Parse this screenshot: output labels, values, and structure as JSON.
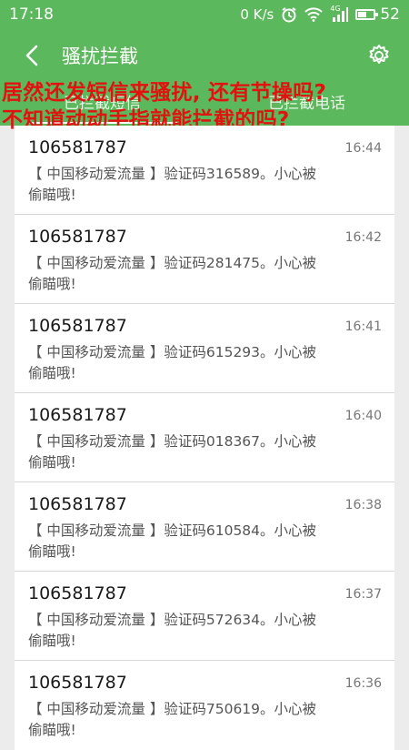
{
  "status_bar": {
    "time": "17:18",
    "data_speed": "0 K/s",
    "network_label": "4G",
    "battery_level": "52",
    "battery_fraction": 0.52
  },
  "app_bar": {
    "title": "骚扰拦截",
    "back_icon": "chevron-left-icon",
    "settings_icon": "gear-icon"
  },
  "tabs": [
    {
      "label": "已拦截短信",
      "active": true
    },
    {
      "label": "已拦截电话",
      "active": false
    }
  ],
  "overlay": {
    "line1": "居然还发短信来骚扰, 还有节操吗?",
    "line2": "不知道动动手指就能拦截的吗?"
  },
  "messages": [
    {
      "sender": "106581787",
      "time": "16:44",
      "text": "【 中国移动爱流量 】验证码316589。小心被偷瞄哦!"
    },
    {
      "sender": "106581787",
      "time": "16:42",
      "text": "【 中国移动爱流量 】验证码281475。小心被偷瞄哦!"
    },
    {
      "sender": "106581787",
      "time": "16:41",
      "text": "【 中国移动爱流量 】验证码615293。小心被偷瞄哦!"
    },
    {
      "sender": "106581787",
      "time": "16:40",
      "text": "【 中国移动爱流量 】验证码018367。小心被偷瞄哦!"
    },
    {
      "sender": "106581787",
      "time": "16:38",
      "text": "【 中国移动爱流量 】验证码610584。小心被偷瞄哦!"
    },
    {
      "sender": "106581787",
      "time": "16:37",
      "text": "【 中国移动爱流量 】验证码572634。小心被偷瞄哦!"
    },
    {
      "sender": "106581787",
      "time": "16:36",
      "text": "【 中国移动爱流量 】验证码750619。小心被偷瞄哦!"
    }
  ],
  "colors": {
    "primary": "#5cb85c",
    "overlay_text": "#e0140f",
    "background": "#ececec"
  }
}
